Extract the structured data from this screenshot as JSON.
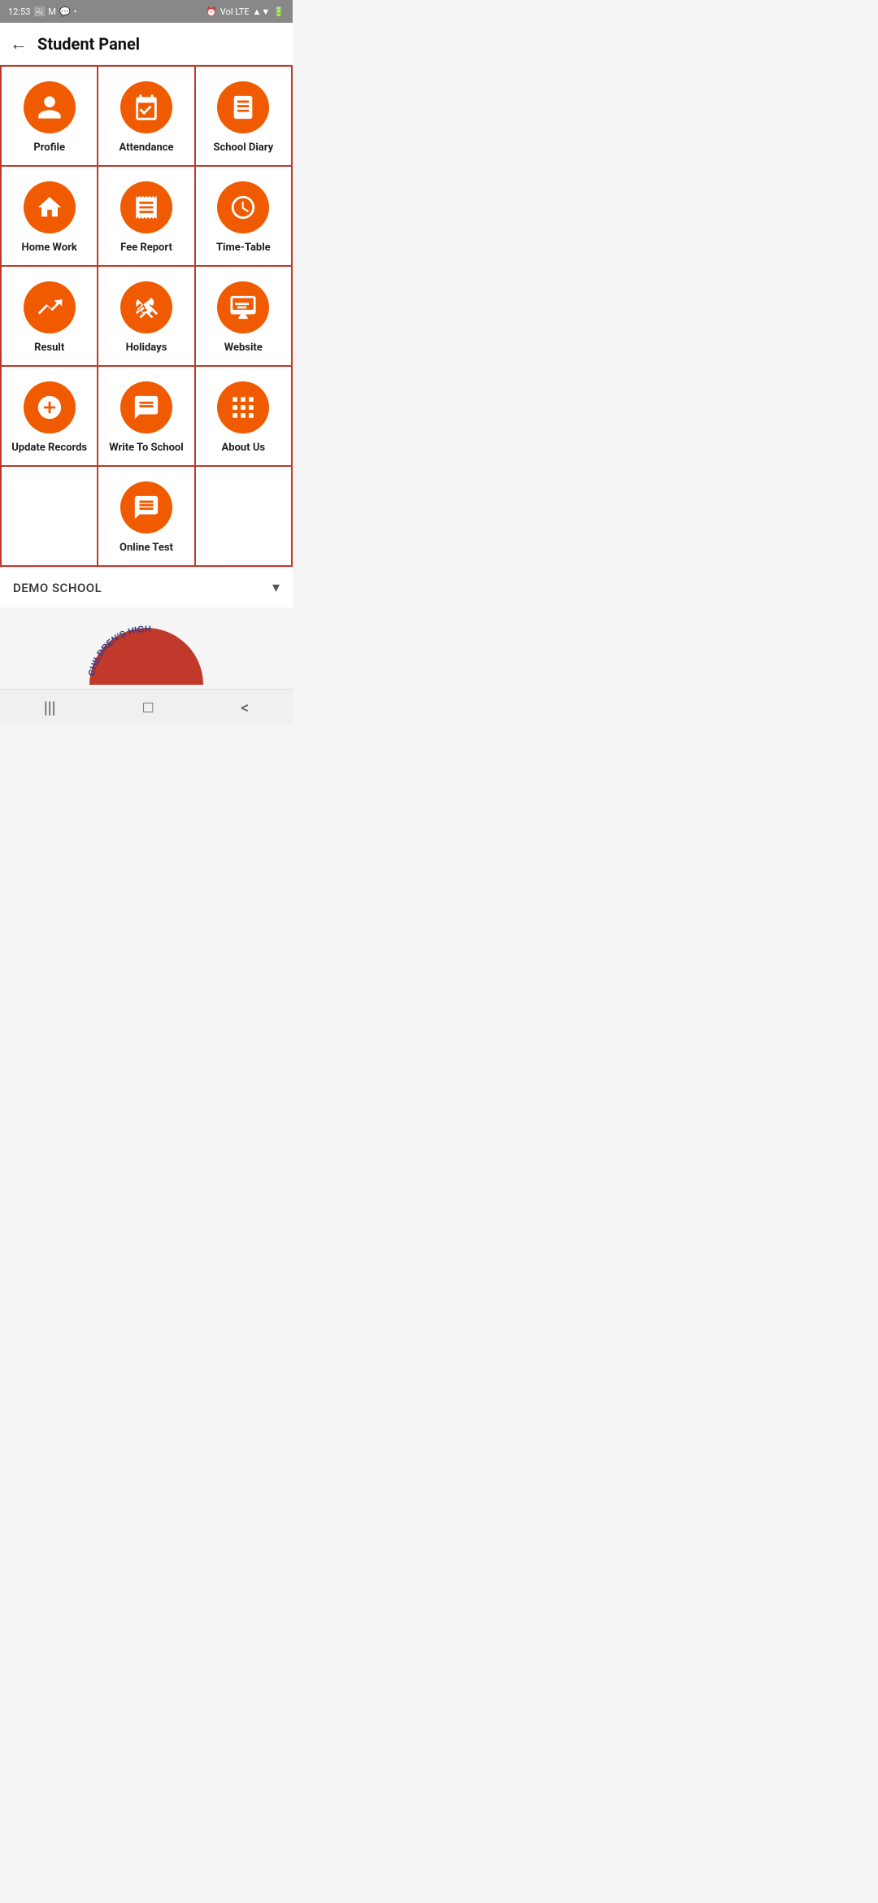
{
  "status": {
    "time": "12:53",
    "right_icons": "VOl LTE ▲▼ ■"
  },
  "header": {
    "title": "Student Panel",
    "back_label": "←"
  },
  "grid": {
    "rows": [
      [
        {
          "id": "profile",
          "label": "Profile",
          "icon": "person"
        },
        {
          "id": "attendance",
          "label": "Attendance",
          "icon": "calendar-check"
        },
        {
          "id": "school-diary",
          "label": "School Diary",
          "icon": "book"
        }
      ],
      [
        {
          "id": "homework",
          "label": "Home Work",
          "icon": "home"
        },
        {
          "id": "fee-report",
          "label": "Fee Report",
          "icon": "receipt"
        },
        {
          "id": "timetable",
          "label": "Time-Table",
          "icon": "clock"
        }
      ],
      [
        {
          "id": "result",
          "label": "Result",
          "icon": "trending-up"
        },
        {
          "id": "holidays",
          "label": "Holidays",
          "icon": "beach"
        },
        {
          "id": "website",
          "label": "Website",
          "icon": "monitor"
        }
      ],
      [
        {
          "id": "update-records",
          "label": "Update Records",
          "icon": "plus-circle"
        },
        {
          "id": "write-to-school",
          "label": "Write To School",
          "icon": "message"
        },
        {
          "id": "about-us",
          "label": "About Us",
          "icon": "grid"
        }
      ],
      [
        {
          "id": "empty-1",
          "label": "",
          "icon": ""
        },
        {
          "id": "online-test",
          "label": "Online Test",
          "icon": "chat"
        },
        {
          "id": "empty-2",
          "label": "",
          "icon": ""
        }
      ]
    ]
  },
  "footer": {
    "school_name": "DEMO SCHOOL",
    "dropdown_symbol": "▾"
  },
  "logo": {
    "text": "CHILDREN'S HIGH"
  },
  "navbar": {
    "menu_icon": "|||",
    "home_icon": "□",
    "back_icon": "<"
  },
  "accent_color": "#f05a00"
}
